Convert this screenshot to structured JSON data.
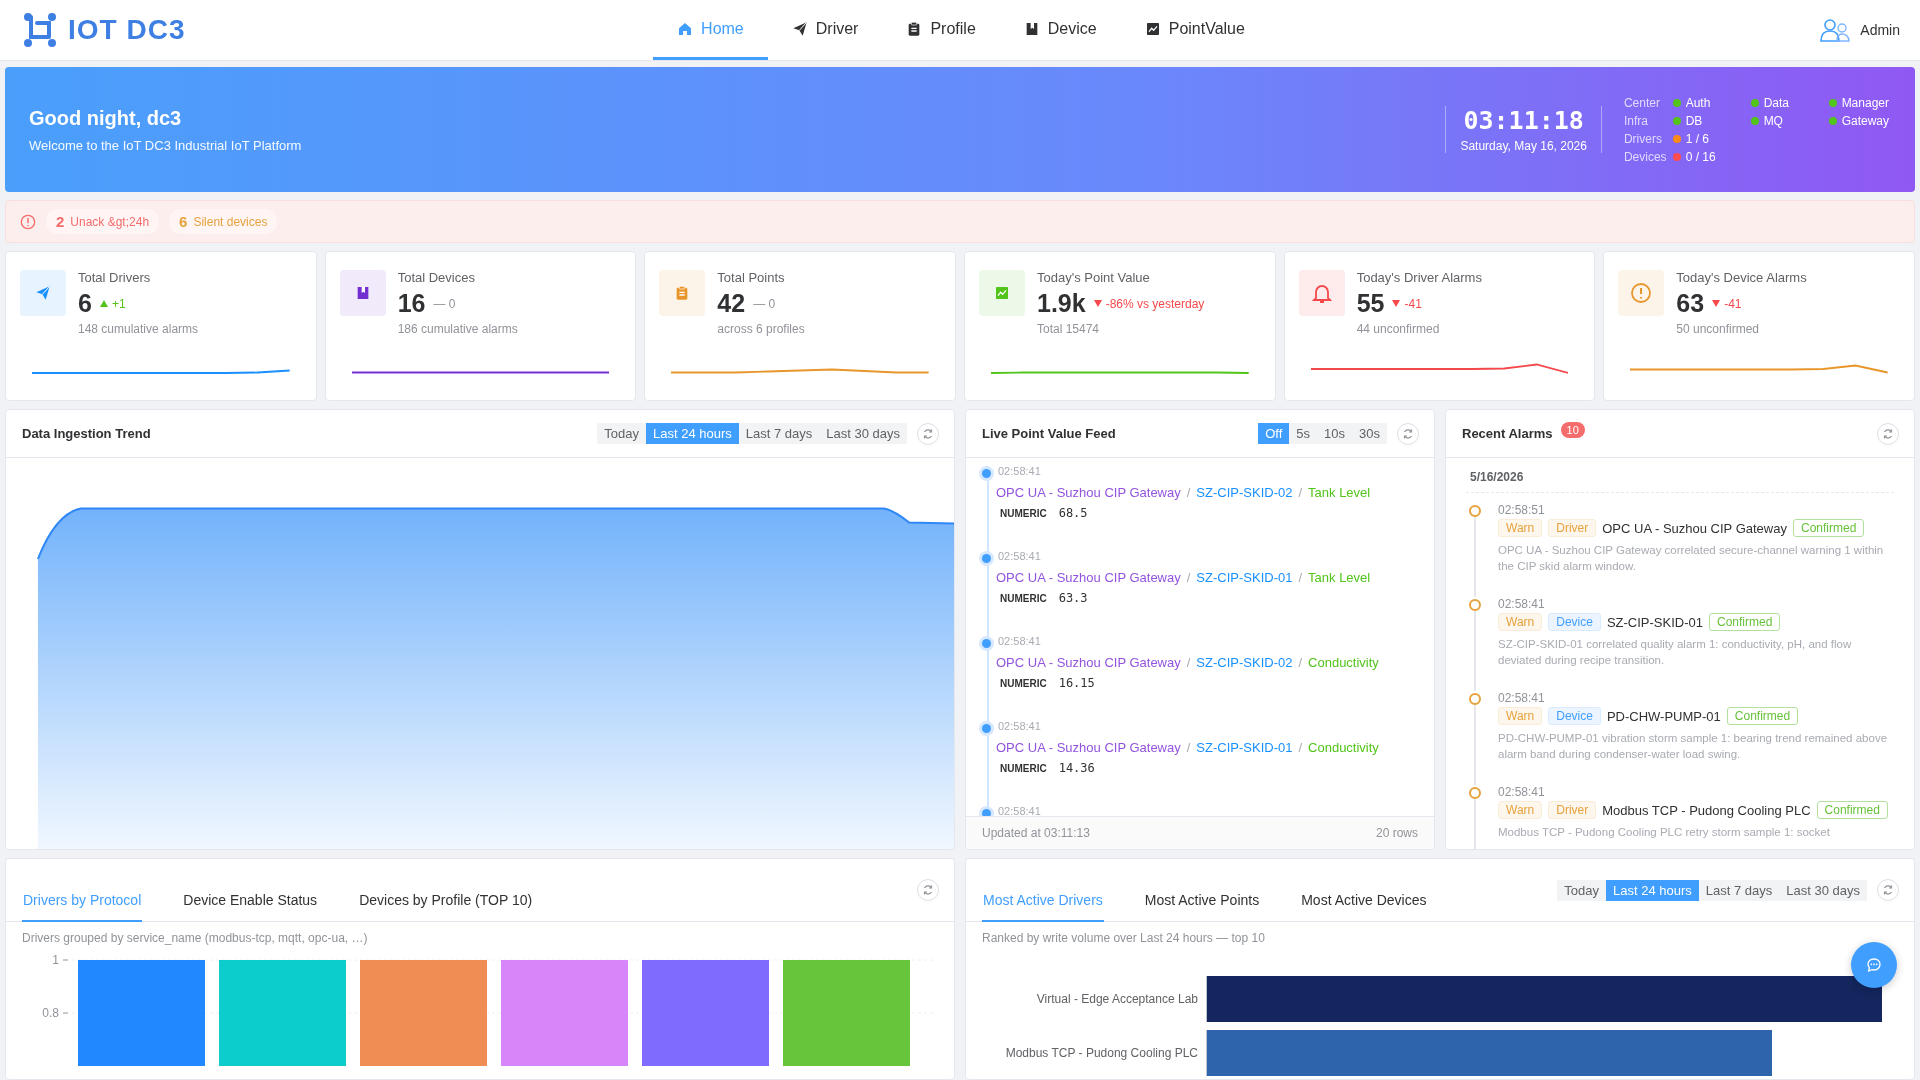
{
  "header": {
    "logo_text": "IOT DC3",
    "user": "Admin",
    "nav": [
      {
        "label": "Home",
        "selected": true
      },
      {
        "label": "Driver",
        "selected": false
      },
      {
        "label": "Profile",
        "selected": false
      },
      {
        "label": "Device",
        "selected": false
      },
      {
        "label": "PointValue",
        "selected": false
      }
    ]
  },
  "banner": {
    "greeting": "Good night, dc3",
    "subtitle": "Welcome to the IoT DC3 Industrial IoT Platform",
    "clock": "03:11:18",
    "date": "Saturday, May 16, 2026",
    "status_rows": [
      {
        "label": "Center",
        "items": [
          {
            "text": "Auth",
            "color": "#52c41a"
          },
          {
            "text": "Data",
            "color": "#52c41a"
          },
          {
            "text": "Manager",
            "color": "#52c41a"
          }
        ]
      },
      {
        "label": "Infra",
        "items": [
          {
            "text": "DB",
            "color": "#52c41a"
          },
          {
            "text": "MQ",
            "color": "#52c41a"
          },
          {
            "text": "Gateway",
            "color": "#52c41a"
          }
        ]
      },
      {
        "label": "Drivers",
        "items": [
          {
            "text": "1 / 6",
            "color": "#fa8c16"
          }
        ]
      },
      {
        "label": "Devices",
        "items": [
          {
            "text": "0 / 16",
            "color": "#ff4d4f"
          }
        ]
      }
    ]
  },
  "alert_bar": {
    "items": [
      {
        "count": "2",
        "text": "Unack &gt;24h",
        "kind": "danger"
      },
      {
        "count": "6",
        "text": "Silent devices",
        "kind": "warning"
      }
    ]
  },
  "stat_cards": [
    {
      "title": "Total Drivers",
      "value": "6",
      "delta": "+1",
      "kind": "up",
      "note": "148 cumulative alarms",
      "color": "#1890ff"
    },
    {
      "title": "Total Devices",
      "value": "16",
      "delta": "— 0",
      "kind": "flat",
      "note": "186 cumulative alarms",
      "color": "#722ed1"
    },
    {
      "title": "Total Points",
      "value": "42",
      "delta": "— 0",
      "kind": "flat",
      "note": "across 6 profiles",
      "color": "#e8962b"
    },
    {
      "title": "Today's Point Value",
      "value": "1.9k",
      "delta": "-86% vs yesterday",
      "kind": "down",
      "note": "Total 15474",
      "color": "#52c41a"
    },
    {
      "title": "Today's Driver Alarms",
      "value": "55",
      "delta": "-41",
      "kind": "down",
      "note": "44 unconfirmed",
      "color": "#f5484b"
    },
    {
      "title": "Today's Device Alarms",
      "value": "63",
      "delta": "-41",
      "kind": "down",
      "note": "50 unconfirmed",
      "color": "#e8962b"
    }
  ],
  "ingestion_trend": {
    "title": "Data Ingestion Trend",
    "ranges": [
      {
        "label": "Today",
        "selected": false
      },
      {
        "label": "Last 24 hours",
        "selected": true
      },
      {
        "label": "Last 7 days",
        "selected": false
      },
      {
        "label": "Last 30 days",
        "selected": false
      }
    ]
  },
  "live_feed": {
    "title": "Live Point Value Feed",
    "intervals": [
      {
        "label": "Off",
        "selected": true
      },
      {
        "label": "5s",
        "selected": false
      },
      {
        "label": "10s",
        "selected": false
      },
      {
        "label": "30s",
        "selected": false
      }
    ],
    "entries": [
      {
        "time": "02:58:41",
        "driver": "OPC UA - Suzhou CIP Gateway",
        "device": "SZ-CIP-SKID-02",
        "point": "Tank Level",
        "separators": [
          "/",
          "/"
        ],
        "type": "NUMERIC",
        "value": "68.5"
      },
      {
        "time": "02:58:41",
        "driver": "OPC UA - Suzhou CIP Gateway",
        "device": "SZ-CIP-SKID-01",
        "point": "Tank Level",
        "separators": [
          "/",
          "/"
        ],
        "type": "NUMERIC",
        "value": "63.3"
      },
      {
        "time": "02:58:41",
        "driver": "OPC UA - Suzhou CIP Gateway",
        "device": "SZ-CIP-SKID-02",
        "point": "Conductivity",
        "separators": [
          "/",
          "/"
        ],
        "type": "NUMERIC",
        "value": "16.15"
      },
      {
        "time": "02:58:41",
        "driver": "OPC UA - Suzhou CIP Gateway",
        "device": "SZ-CIP-SKID-01",
        "point": "Conductivity",
        "separators": [
          "/",
          "/"
        ],
        "type": "NUMERIC",
        "value": "14.36"
      },
      {
        "time": "02:58:41"
      }
    ],
    "updated": "Updated at 03:11:13",
    "rows": "20 rows"
  },
  "recent_alarms": {
    "title": "Recent Alarms",
    "count": "10",
    "date": "5/16/2026",
    "items": [
      {
        "time": "02:58:51",
        "level": "Warn",
        "source": "Driver",
        "kind": "driver",
        "name": "OPC UA - Suzhou CIP Gateway",
        "status": "Confirmed",
        "confirmed": true,
        "message": "OPC UA - Suzhou CIP Gateway correlated secure-channel warning 1 within the CIP skid alarm window."
      },
      {
        "time": "02:58:41",
        "level": "Warn",
        "source": "Device",
        "kind": "device",
        "name": "SZ-CIP-SKID-01",
        "status": "Confirmed",
        "confirmed": true,
        "message": "SZ-CIP-SKID-01 correlated quality alarm 1: conductivity, pH, and flow deviated during recipe transition."
      },
      {
        "time": "02:58:41",
        "level": "Warn",
        "source": "Device",
        "kind": "device",
        "name": "PD-CHW-PUMP-01",
        "status": "Confirmed",
        "confirmed": true,
        "message": "PD-CHW-PUMP-01 vibration storm sample 1: bearing trend remained above alarm band during condenser-water load swing."
      },
      {
        "time": "02:58:41",
        "level": "Warn",
        "source": "Driver",
        "kind": "driver",
        "name": "Modbus TCP - Pudong Cooling PLC",
        "status": "Confirmed",
        "confirmed": true,
        "message": "Modbus TCP - Pudong Cooling PLC retry storm sample 1: socket"
      }
    ]
  },
  "distribution": {
    "tabs": [
      {
        "label": "Drivers by Protocol",
        "selected": true
      },
      {
        "label": "Device Enable Status",
        "selected": false
      },
      {
        "label": "Devices by Profile (TOP 10)",
        "selected": false
      }
    ],
    "subtitle": "Drivers grouped by service_name (modbus-tcp, mqtt, opc-ua, …)",
    "chart_data": {
      "type": "bar",
      "values": [
        1,
        1,
        1,
        1,
        1,
        1
      ],
      "colors": [
        "#2288ff",
        "#0ccccc",
        "#f08d55",
        "#d786fa",
        "#7f6cff",
        "#66c53a"
      ],
      "ylim": [
        0.6,
        1
      ],
      "yticks": [
        {
          "value": 0.8,
          "label": "0.8"
        },
        {
          "value": 1,
          "label": "1"
        }
      ]
    }
  },
  "activity": {
    "tabs": [
      {
        "label": "Most Active Drivers",
        "selected": true
      },
      {
        "label": "Most Active Points",
        "selected": false
      },
      {
        "label": "Most Active Devices",
        "selected": false
      }
    ],
    "ranges": [
      {
        "label": "Today",
        "selected": false
      },
      {
        "label": "Last 24 hours",
        "selected": true
      },
      {
        "label": "Last 7 days",
        "selected": false
      },
      {
        "label": "Last 30 days",
        "selected": false
      }
    ],
    "subtitle": "Ranked by write volume over Last 24 hours — top 10",
    "bars": [
      {
        "label": "Virtual - Edge Acceptance Lab",
        "level": 1,
        "color": "#14265e"
      },
      {
        "label": "Modbus TCP - Pudong Cooling PLC",
        "level": 0.837,
        "color": "#2e64ab"
      }
    ]
  }
}
